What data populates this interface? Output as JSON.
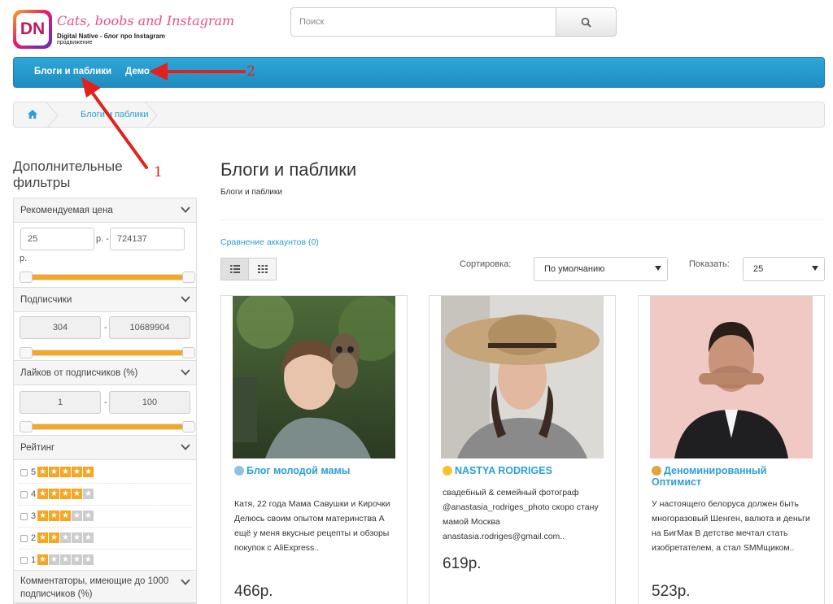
{
  "header": {
    "logo_text": "DN",
    "site_title": "Cats, boobs and Instagram",
    "tagline_1": "Digital Native - блог про Instagram",
    "tagline_2": "продвижение",
    "search_placeholder": "Поиск",
    "search_icon": "search-icon"
  },
  "nav": {
    "items": [
      {
        "label": "Блоги и паблики"
      },
      {
        "label": "Демо"
      }
    ]
  },
  "breadcrumb": {
    "home_icon": "home-icon",
    "current": "Блоги и паблики"
  },
  "sidebar": {
    "title": "Дополнительные фильтры",
    "price": {
      "label": "Рекомендуемая цена",
      "min": "25",
      "max": "724137",
      "unit_mid": "р. -",
      "unit_end": "р."
    },
    "subscribers": {
      "label": "Подписчики",
      "min": "304",
      "sep": "-",
      "max": "10689904"
    },
    "likes": {
      "label": "Лайков от подписчиков (%)",
      "min": "1",
      "sep": "-",
      "max": "100"
    },
    "rating": {
      "label": "Рейтинг",
      "rows": [
        {
          "value": "5",
          "stars": 5
        },
        {
          "value": "4",
          "stars": 4
        },
        {
          "value": "3",
          "stars": 3
        },
        {
          "value": "2",
          "stars": 2
        },
        {
          "value": "1",
          "stars": 1
        }
      ]
    },
    "commentators": {
      "label": "Комментаторы, имеющие до 1000 подписчиков (%)"
    }
  },
  "main": {
    "heading": "Блоги и паблики",
    "subheading": "Блоги и паблики",
    "compare_link": "Сравнение аккаунтов (0)",
    "sort_label": "Сортировка:",
    "sort_value": "По умолчанию",
    "show_label": "Показать:",
    "show_value": "25",
    "cards": [
      {
        "title": "Блог молодой мамы",
        "desc": "Катя, 22 года Мама Савушки и Кирочки Делюсь своим опытом материнства А ещё у меня вкусные рецепты и обзоры покупок с AliExpress..",
        "price": "466р."
      },
      {
        "title": "NASTYA RODRIGES",
        "desc": "свадебный & семейный фотограф @anastasia_rodriges_photo скоро стану мамой Москва anastasia.rodriges@gmail.com..",
        "price": "619р."
      },
      {
        "title": "Деноминированный Оптимист",
        "desc": "У настоящего белоруса должен быть многоразовый Шенген, валюта и деньги на БигМак В детстве мечтал стать изобретателем, а стал SMMщиком..",
        "price": "523р."
      }
    ]
  },
  "annotations": {
    "label_1": "1",
    "label_2": "2"
  },
  "colors": {
    "accent": "#2a9fd6",
    "slider": "#f5a623",
    "annotation": "#e2201c"
  }
}
